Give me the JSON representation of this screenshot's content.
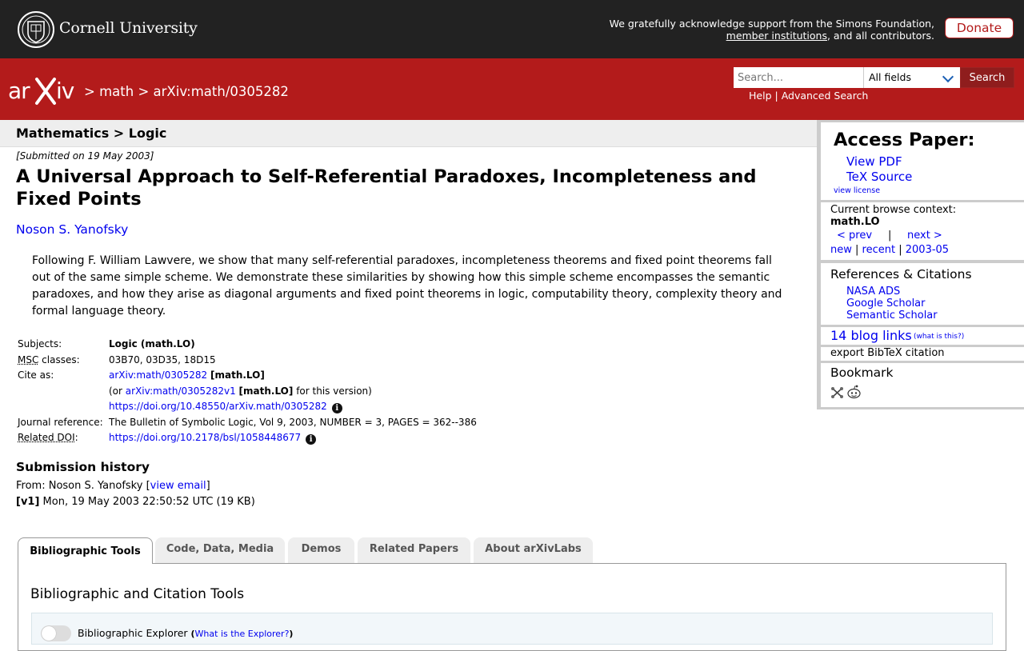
{
  "top": {
    "institution": "Cornell University",
    "ack_line1": "We gratefully acknowledge support from the Simons Foundation,",
    "ack_link": "member institutions",
    "ack_rest": ", and all contributors.",
    "donate": "Donate"
  },
  "header": {
    "breadcrumb_sep": ">",
    "crumb_math": "math",
    "crumb_paper": "arXiv:math/0305282",
    "search_placeholder": "Search...",
    "field_select": "All fields",
    "search_button": "Search",
    "help": "Help",
    "help_sep": "|",
    "advanced": "Advanced Search"
  },
  "subheader": "Mathematics > Logic",
  "paper": {
    "submitted": "[Submitted on 19 May 2003]",
    "title": "A Universal Approach to Self-Referential Paradoxes, Incompleteness and Fixed Points",
    "author": "Noson S. Yanofsky",
    "abstract": "Following F. William Lawvere, we show that many self-referential paradoxes, incompleteness theorems and fixed point theorems fall out of the same simple scheme. We demonstrate these similarities by showing how this simple scheme encompasses the semantic paradoxes, and how they arise as diagonal arguments and fixed point theorems in logic, computability theory, complexity theory and formal language theory."
  },
  "meta": {
    "subjects_label": "Subjects:",
    "subjects": "Logic (math.LO)",
    "msc_label_abbr": "MSC",
    "msc_label_rest": " classes:",
    "msc": "03B70, 03D35, 18D15",
    "cite_label": "Cite as:",
    "cite_id": "arXiv:math/0305282",
    "cite_tag": "[math.LO]",
    "cite_or": "(or",
    "cite_v1": "arXiv:math/0305282v1",
    "cite_v1_tag": "[math.LO]",
    "cite_version": "for this version)",
    "cite_doi": "https://doi.org/10.48550/arXiv.math/0305282",
    "journal_label": "Journal reference:",
    "journal": "The Bulletin of Symbolic Logic, Vol 9, 2003, NUMBER = 3, PAGES = 362--386",
    "related_label_abbr": "Related DOI",
    "related_label_colon": ":",
    "related_doi": "https://doi.org/10.2178/bsl/1058448677",
    "info_glyph": "i"
  },
  "history": {
    "heading": "Submission history",
    "from_prefix": "From: Noson S. Yanofsky [",
    "view_email": "view email",
    "from_suffix": "]",
    "v1_tag": "[v1]",
    "v1_text": " Mon, 19 May 2003 22:50:52 UTC (19 KB)"
  },
  "tabs": [
    "Bibliographic Tools",
    "Code, Data, Media",
    "Demos",
    "Related Papers",
    "About arXivLabs"
  ],
  "panel": {
    "heading": "Bibliographic and Citation Tools",
    "explorer": "Bibliographic Explorer",
    "explorer_open": "(",
    "explorer_link": "What is the Explorer?",
    "explorer_close": ")"
  },
  "sidebar": {
    "access_heading": "Access Paper:",
    "view_pdf": "View PDF",
    "tex_source": "TeX Source",
    "view_license": "view license",
    "context_label": "Current browse context:",
    "context": "math.LO",
    "prev": "< prev",
    "nav_sep": "|",
    "next": "next >",
    "new": "new",
    "recent": "recent",
    "month": "2003-05",
    "refs_heading": "References & Citations",
    "nasa": "NASA ADS",
    "google": "Google Scholar",
    "semantic": "Semantic Scholar",
    "blog_links": "14 blog links",
    "what_is_this": "(what is this?)",
    "bibtex": "export BibTeX citation",
    "bookmark": "Bookmark"
  },
  "colors": {
    "arxiv_red": "#b31b1b",
    "top_dark": "#222222",
    "link_blue": "#0000ee"
  }
}
